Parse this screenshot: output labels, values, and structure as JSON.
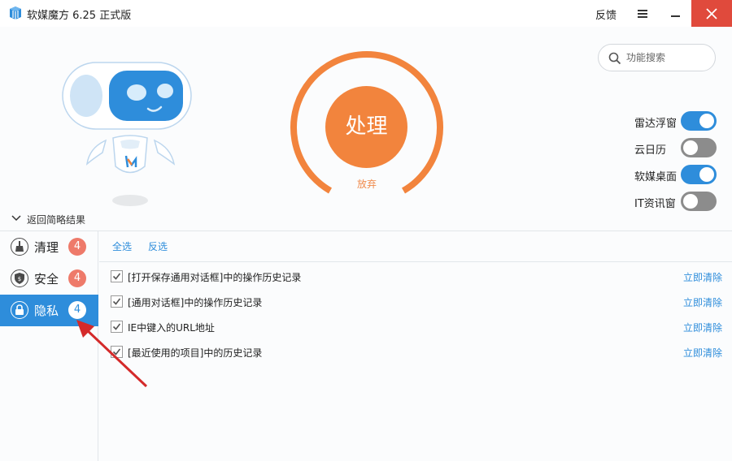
{
  "app": {
    "title": "软媒魔方 6.25 正式版",
    "feedback": "反馈"
  },
  "search": {
    "placeholder": "功能搜索"
  },
  "main": {
    "process_label": "处理",
    "abandon_label": "放弃"
  },
  "toggles": [
    {
      "label": "雷达浮窗",
      "on": true
    },
    {
      "label": "云日历",
      "on": false
    },
    {
      "label": "软媒桌面",
      "on": true
    },
    {
      "label": "IT资讯窗",
      "on": false
    }
  ],
  "back_label": "返回简略结果",
  "sidebar": {
    "items": [
      {
        "label": "清理",
        "badge": "4",
        "icon": "broom-icon"
      },
      {
        "label": "安全",
        "badge": "4",
        "icon": "shield-icon"
      },
      {
        "label": "隐私",
        "badge": "4",
        "icon": "lock-icon",
        "active": true
      }
    ]
  },
  "toolbar": {
    "select_all": "全选",
    "invert": "反选"
  },
  "rows": [
    {
      "text": "[打开保存通用对话框]中的操作历史记录",
      "action": "立即清除",
      "checked": true
    },
    {
      "text": "[通用对话框]中的操作历史记录",
      "action": "立即清除",
      "checked": true
    },
    {
      "text": "IE中键入的URL地址",
      "action": "立即清除",
      "checked": true
    },
    {
      "text": "[最近使用的项目]中的历史记录",
      "action": "立即清除",
      "checked": true
    }
  ],
  "colors": {
    "accent": "#2e8ddb",
    "orange": "#f2843d",
    "close": "#e04a3c",
    "badge": "#ee7a6a"
  }
}
